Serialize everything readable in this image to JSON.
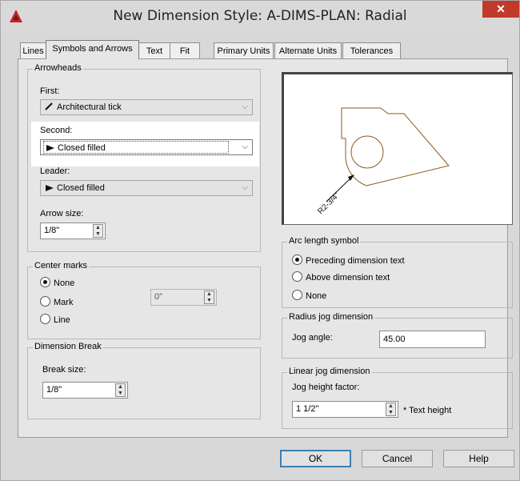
{
  "window": {
    "title": "New Dimension Style: A-DIMS-PLAN: Radial",
    "close": "✕"
  },
  "tabs": [
    "Lines",
    "Symbols and Arrows",
    "Text",
    "Fit",
    "Primary Units",
    "Alternate Units",
    "Tolerances"
  ],
  "arrowheads": {
    "title": "Arrowheads",
    "first_label": "First:",
    "first_value": "Architectural tick",
    "second_label": "Second:",
    "second_value": "Closed filled",
    "leader_label": "Leader:",
    "leader_value": "Closed filled",
    "arrow_size_label": "Arrow size:",
    "arrow_size_value": "1/8\""
  },
  "center_marks": {
    "title": "Center marks",
    "options": [
      "None",
      "Mark",
      "Line"
    ],
    "selected": "None",
    "size_value": "0\""
  },
  "dimension_break": {
    "title": "Dimension Break",
    "break_size_label": "Break size:",
    "break_size_value": "1/8\""
  },
  "preview": {
    "dim_text": "R2-3/4\""
  },
  "arc_length_symbol": {
    "title": "Arc length symbol",
    "options": [
      "Preceding dimension text",
      "Above dimension text",
      "None"
    ],
    "selected": "Preceding dimension text"
  },
  "radius_jog": {
    "title": "Radius jog dimension",
    "jog_angle_label": "Jog angle:",
    "jog_angle_value": "45.00"
  },
  "linear_jog": {
    "title": "Linear jog dimension",
    "height_factor_label": "Jog height factor:",
    "height_factor_value": "1 1/2\"",
    "suffix": "* Text height"
  },
  "buttons": {
    "ok": "OK",
    "cancel": "Cancel",
    "help": "Help"
  },
  "colors": {
    "accent": "#3c7fb1",
    "preview_outline": "#8b5a1e",
    "close": "#c0392b"
  }
}
